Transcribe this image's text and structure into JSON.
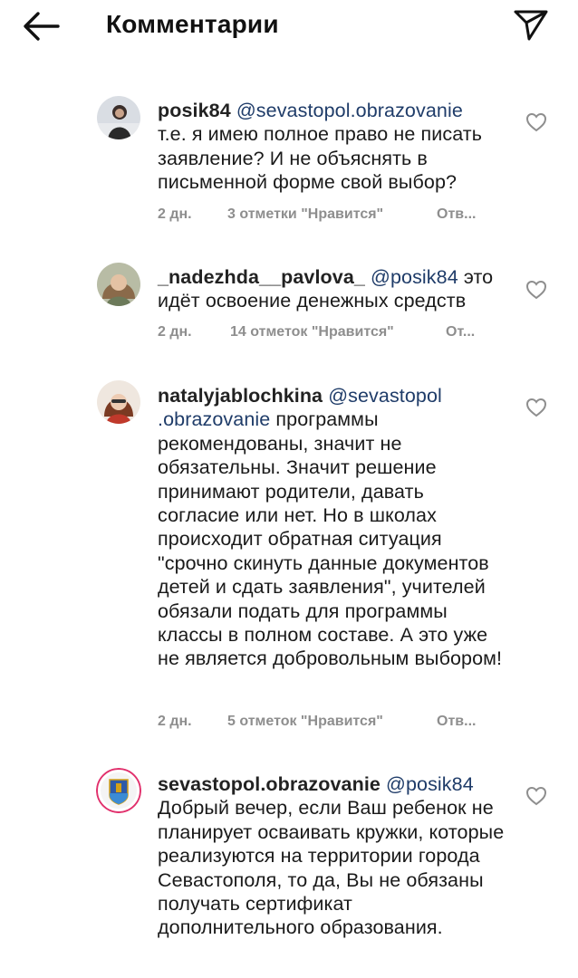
{
  "header": {
    "title": "Комментарии",
    "back_icon": "arrow-left-icon",
    "share_icon": "send-paper-plane-icon"
  },
  "comments": [
    {
      "username": "posik84",
      "mention": "@sevastopol.obrazovanie",
      "text": "т.е. я имею полное право не писать заявление? И не объяснять в письменной форме свой выбор?",
      "age": "2 дн.",
      "likes": "3 отметки \"Нравится\"",
      "reply": "Отв..."
    },
    {
      "username": "_nadezhda__pavlova_",
      "mention": "@posik84",
      "text": "это идёт освоение денежных средств",
      "age": "2 дн.",
      "likes": "14 отметок \"Нравится\"",
      "reply": "От..."
    },
    {
      "username": "natalyjablochkina",
      "mention": "@sevastopol .obrazovanie",
      "text": "программы рекомендованы, значит не обязательны. Значит решение принимают родители, давать согласие или нет. Но в школах происходит обратная ситуация \"срочно скинуть данные документов детей и сдать заявления\", учителей обязали подать для программы классы в полном составе. А это уже не является добровольным выбором!",
      "age": "2 дн.",
      "likes": "5 отметок \"Нравится\"",
      "reply": "Отв..."
    },
    {
      "username": "sevastopol.obrazovanie",
      "mention": "@posik84",
      "text": "Добрый вечер, если Ваш ребенок не планирует осваивать кружки, которые реализуются на территории города Севастополя, то да, Вы не обязаны получать сертификат дополнительного образования."
    }
  ]
}
